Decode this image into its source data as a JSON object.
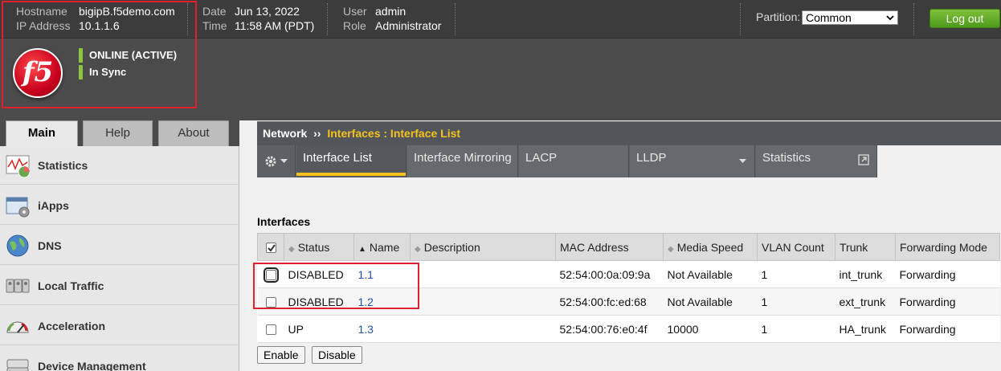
{
  "header": {
    "hostname_label": "Hostname",
    "hostname": "bigipB.f5demo.com",
    "ip_label": "IP Address",
    "ip": "10.1.1.6",
    "date_label": "Date",
    "date": "Jun 13, 2022",
    "time_label": "Time",
    "time": "11:58 AM (PDT)",
    "user_label": "User",
    "user": "admin",
    "role_label": "Role",
    "role": "Administrator",
    "partition_label": "Partition:",
    "partition_value": "Common",
    "logout_label": "Log out"
  },
  "brand": {
    "logo_text": "f5",
    "status_online": "ONLINE (ACTIVE)",
    "status_sync": "In Sync",
    "status_color": "#8cc63f"
  },
  "left_tabs": [
    "Main",
    "Help",
    "About"
  ],
  "nav": {
    "items": [
      {
        "label": "Statistics",
        "icon": "statistics-icon"
      },
      {
        "label": "iApps",
        "icon": "iapps-icon"
      },
      {
        "label": "DNS",
        "icon": "dns-icon"
      },
      {
        "label": "Local Traffic",
        "icon": "local-traffic-icon"
      },
      {
        "label": "Acceleration",
        "icon": "acceleration-icon"
      },
      {
        "label": "Device Management",
        "icon": "device-management-icon"
      }
    ]
  },
  "breadcrumb": {
    "root": "Network",
    "separator": "››",
    "path": "Interfaces : Interface List"
  },
  "subtabs": [
    "Interface List",
    "Interface Mirroring",
    "LACP",
    "LLDP",
    "Statistics"
  ],
  "section_title": "Interfaces",
  "table": {
    "columns": [
      "Status",
      "Name",
      "Description",
      "MAC Address",
      "Media Speed",
      "VLAN Count",
      "Trunk",
      "Forwarding Mode"
    ],
    "rows": [
      {
        "status": "DISABLED",
        "name": "1.1",
        "description": "",
        "mac": "52:54:00:0a:09:9a",
        "speed": "Not Available",
        "vlan_count": "1",
        "trunk": "int_trunk",
        "mode": "Forwarding"
      },
      {
        "status": "DISABLED",
        "name": "1.2",
        "description": "",
        "mac": "52:54:00:fc:ed:68",
        "speed": "Not Available",
        "vlan_count": "1",
        "trunk": "ext_trunk",
        "mode": "Forwarding"
      },
      {
        "status": "UP",
        "name": "1.3",
        "description": "",
        "mac": "52:54:00:76:e0:4f",
        "speed": "10000",
        "vlan_count": "1",
        "trunk": "HA_trunk",
        "mode": "Forwarding"
      }
    ]
  },
  "actions": {
    "enable_label": "Enable",
    "disable_label": "Disable"
  },
  "colors": {
    "accent_yellow": "#f4c21b",
    "annotation_red": "#e0202a",
    "logout_green": "#5aa825"
  }
}
